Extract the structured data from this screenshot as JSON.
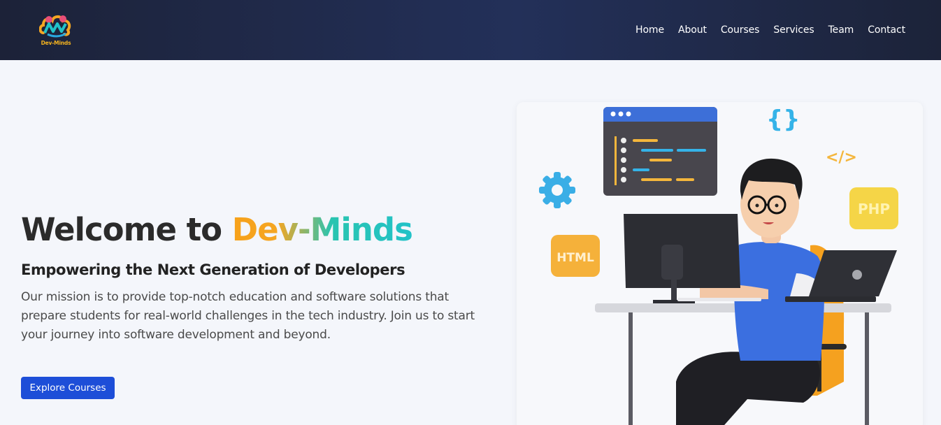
{
  "navbar": {
    "logo_text": "Dev-Minds",
    "links": [
      {
        "label": "Home"
      },
      {
        "label": "About"
      },
      {
        "label": "Courses"
      },
      {
        "label": "Services"
      },
      {
        "label": "Team"
      },
      {
        "label": "Contact"
      }
    ]
  },
  "hero": {
    "title_prefix": "Welcome to ",
    "title_brand_part1": "Dev",
    "title_brand_part2": "-Minds",
    "subtitle": "Empowering the Next Generation of Developers",
    "description": "Our mission is to provide top-notch education and software solutions that prepare students for real-world challenges in the tech industry. Join us to start your journey into software development and beyond.",
    "cta_label": "Explore Courses"
  },
  "illustration": {
    "badges": {
      "html": "HTML",
      "php": "PHP",
      "code_tag": "</>",
      "braces": "{}"
    }
  },
  "colors": {
    "navbar_bg": "#1e2542",
    "page_bg": "#f4f6fb",
    "brand_orange": "#f7a11a",
    "brand_teal": "#22c2c8",
    "cta_blue": "#1d4ed8"
  }
}
